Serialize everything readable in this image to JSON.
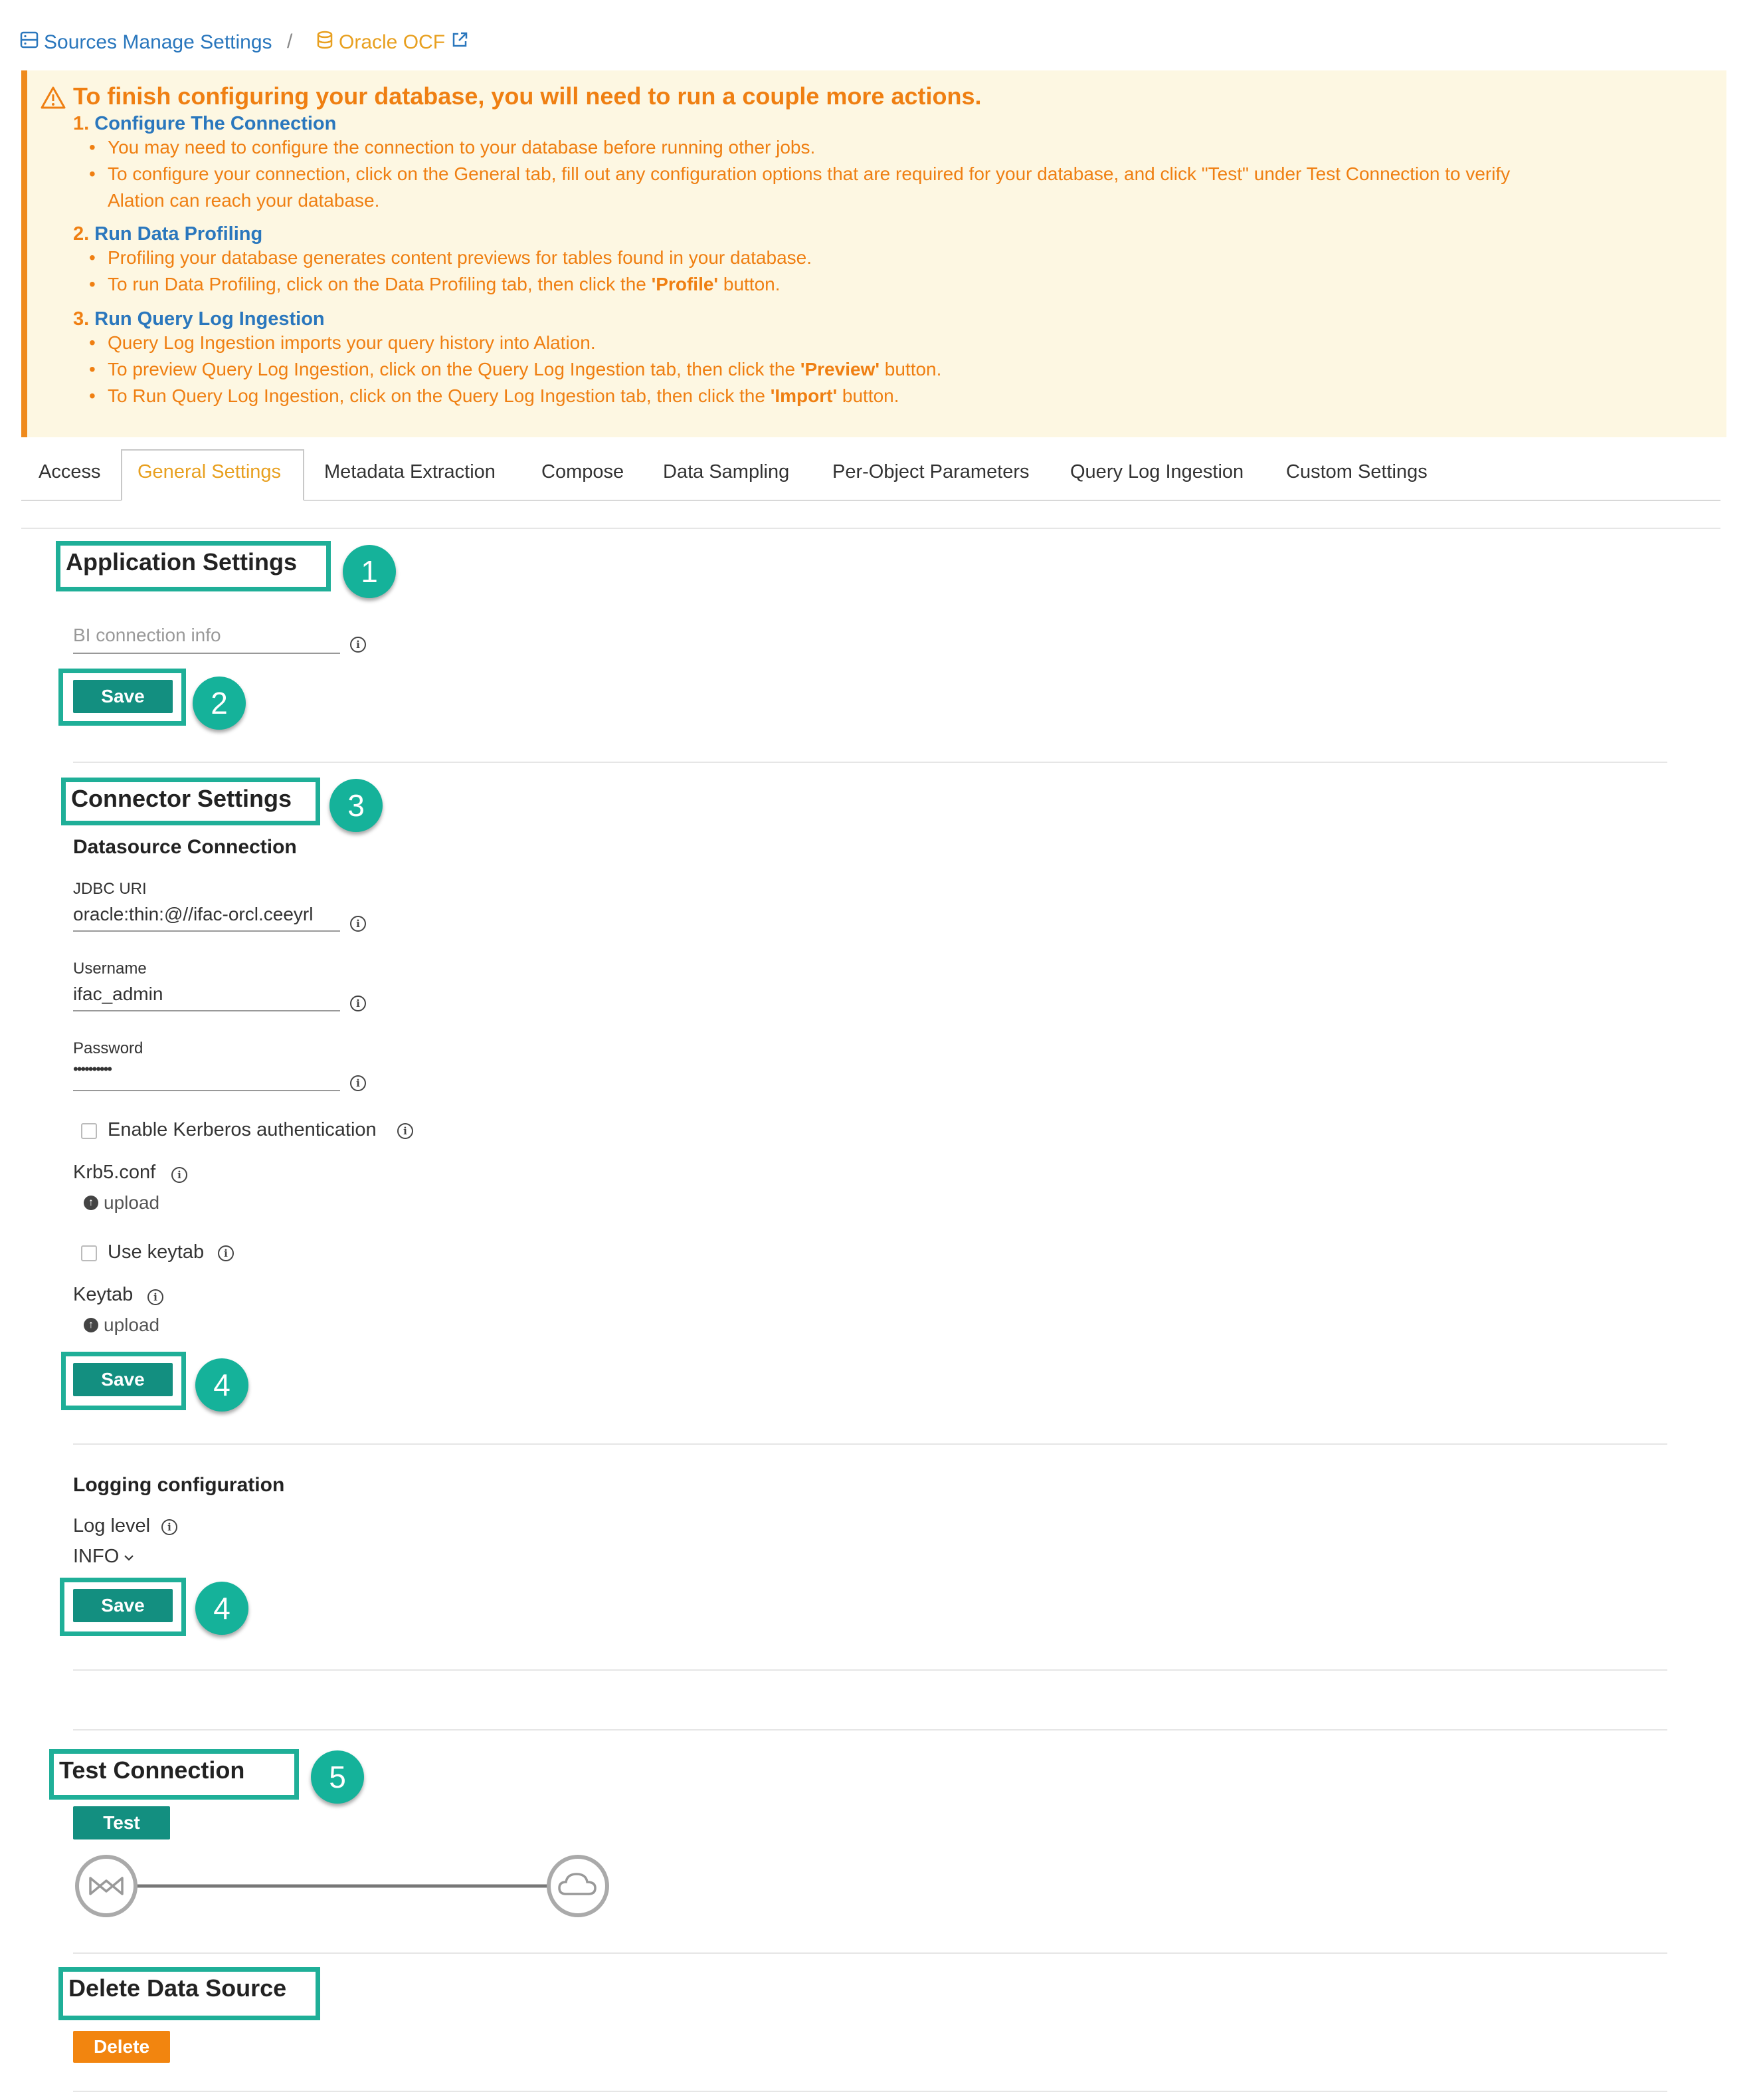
{
  "breadcrumb": {
    "link_label": "Sources Manage Settings",
    "separator": "/",
    "source_label": "Oracle OCF"
  },
  "banner": {
    "title": "To finish configuring your database, you will need to run a couple more actions.",
    "steps": [
      {
        "num": "1.",
        "title": "Configure The Connection",
        "bullets": [
          "You may need to configure the connection to your database before running other jobs.",
          "To configure your connection, click on the General tab, fill out any configuration options that are required for your database, and click \"Test\" under Test Connection to verify",
          "Alation can reach your database."
        ]
      },
      {
        "num": "2.",
        "title": "Run Data Profiling",
        "bullets": [
          "Profiling your database generates content previews for tables found in your database.",
          "To run Data Profiling, click on the Data Profiling tab, then click the",
          "'Profile'",
          "button."
        ]
      },
      {
        "num": "3.",
        "title": "Run Query Log Ingestion",
        "bullets": [
          "Query Log Ingestion imports your query history into Alation.",
          "To preview Query Log Ingestion, click on the Query Log Ingestion tab, then click the",
          "'Preview'",
          "button.",
          "To Run Query Log Ingestion, click on the Query Log Ingestion tab, then click the",
          "'Import'",
          "button."
        ]
      }
    ]
  },
  "tabs": [
    "Access",
    "General Settings",
    "Metadata Extraction",
    "Compose",
    "Data Sampling",
    "Per-Object Parameters",
    "Query Log Ingestion",
    "Custom Settings"
  ],
  "active_tab": "General Settings",
  "app_settings": {
    "title": "Application Settings",
    "badge": "1",
    "bi_placeholder": "BI connection info",
    "save_label": "Save",
    "save_badge": "2"
  },
  "connector": {
    "title": "Connector Settings",
    "badge": "3",
    "subheading": "Datasource Connection",
    "jdbc_label": "JDBC URI",
    "jdbc_value": "oracle:thin:@//ifac-orcl.ceeyrl",
    "username_label": "Username",
    "username_value": "ifac_admin",
    "password_label": "Password",
    "password_value": "••••••••••",
    "kerberos_label": "Enable Kerberos authentication",
    "krb5_label": "Krb5.conf",
    "upload_label": "upload",
    "keytab_check_label": "Use keytab",
    "keytab_label": "Keytab",
    "save_label": "Save",
    "save_badge": "4"
  },
  "logging": {
    "title": "Logging configuration",
    "level_label": "Log level",
    "level_value": "INFO",
    "save_label": "Save",
    "save_badge": "4"
  },
  "test_connection": {
    "title": "Test Connection",
    "badge": "5",
    "button_label": "Test"
  },
  "delete_source": {
    "title": "Delete Data Source",
    "button_label": "Delete"
  },
  "colors": {
    "accent_teal": "#138f80",
    "badge_teal": "#15b29a",
    "warning_orange": "#ef7f12",
    "link_blue": "#2a77bd",
    "banner_bg": "#fdf7e2"
  }
}
